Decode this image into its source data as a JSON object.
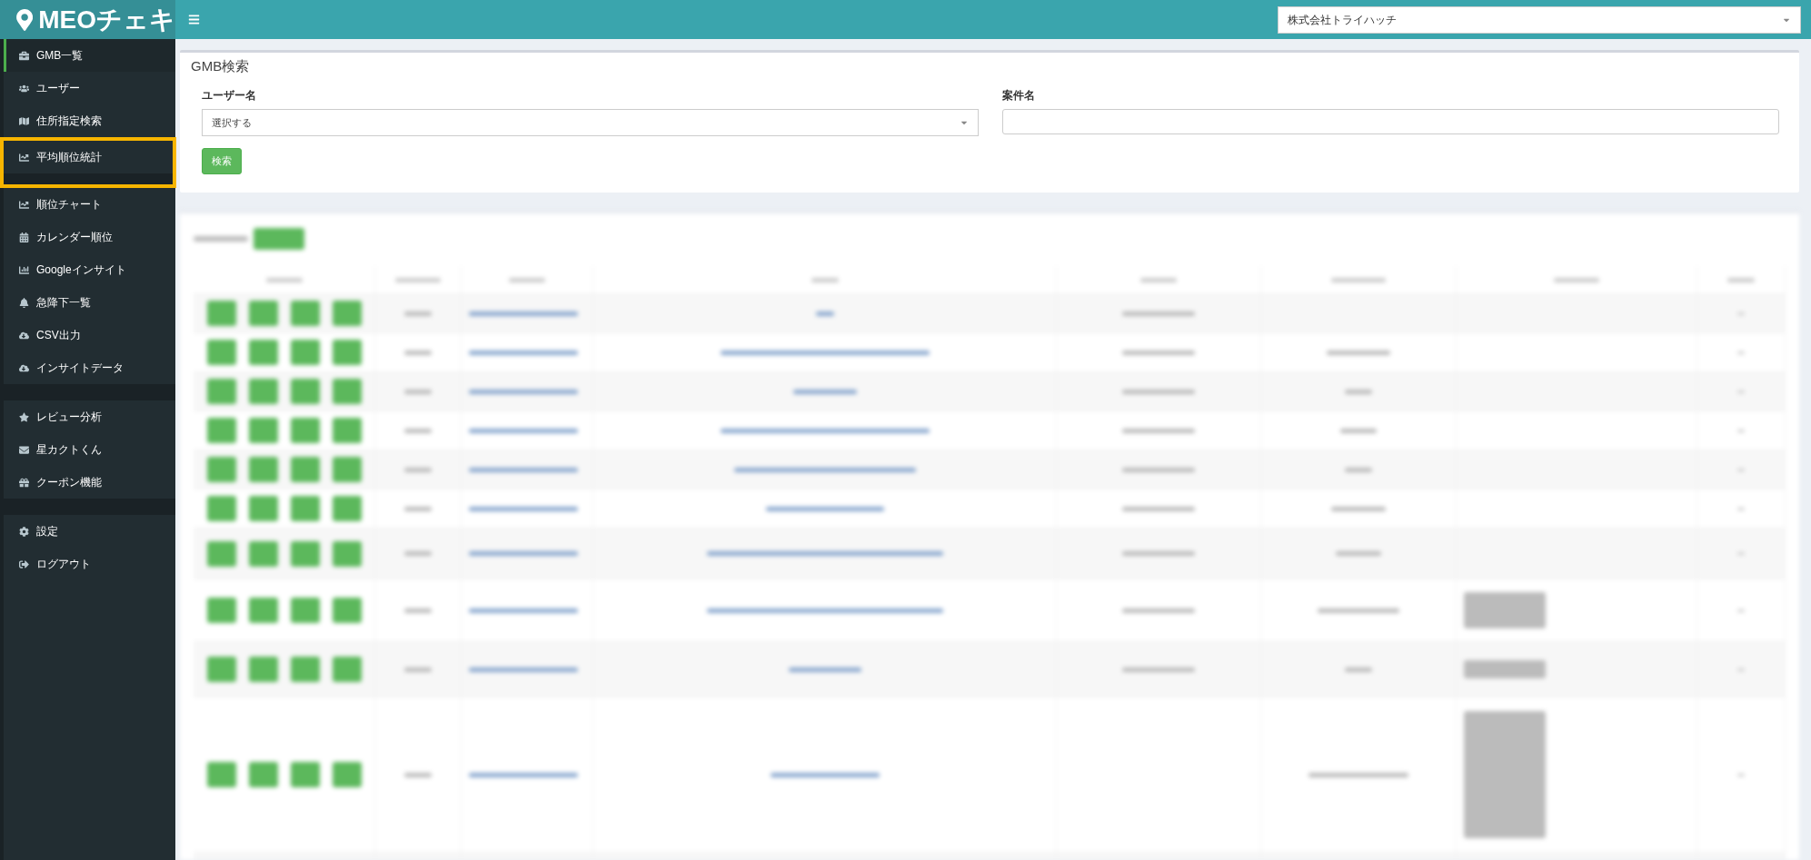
{
  "header": {
    "logo": "MEOチェキ",
    "company_select": {
      "value": "株式会社トライハッチ"
    }
  },
  "sidebar": {
    "groups": [
      {
        "items": [
          {
            "label": "GMB一覧",
            "selected": true,
            "highlighted": false
          },
          {
            "label": "ユーザー",
            "selected": false,
            "highlighted": false
          },
          {
            "label": "住所指定検索",
            "selected": false,
            "highlighted": false
          },
          {
            "label": "平均順位統計",
            "selected": false,
            "highlighted": true
          }
        ]
      },
      {
        "items": [
          {
            "label": "順位チャート",
            "selected": false,
            "highlighted": false
          },
          {
            "label": "カレンダー順位",
            "selected": false,
            "highlighted": false
          },
          {
            "label": "Googleインサイト",
            "selected": false,
            "highlighted": false
          },
          {
            "label": "急降下一覧",
            "selected": false,
            "highlighted": false
          },
          {
            "label": "CSV出力",
            "selected": false,
            "highlighted": false
          },
          {
            "label": "インサイトデータ",
            "selected": false,
            "highlighted": false
          }
        ]
      },
      {
        "items": [
          {
            "label": "レビュー分析",
            "selected": false,
            "highlighted": false
          },
          {
            "label": "星カクトくん",
            "selected": false,
            "highlighted": false
          },
          {
            "label": "クーポン機能",
            "selected": false,
            "highlighted": false
          }
        ]
      },
      {
        "items": [
          {
            "label": "設定",
            "selected": false,
            "highlighted": false
          },
          {
            "label": "ログアウト",
            "selected": false,
            "highlighted": false
          }
        ]
      }
    ]
  },
  "search_panel": {
    "title": "GMB検索",
    "fields": [
      {
        "kind": "select",
        "label": "ユーザー名",
        "value": "選択する"
      },
      {
        "kind": "text",
        "label": "案件名"
      }
    ],
    "button": "検索"
  },
  "results_panel": {
    "kind": "blurred"
  }
}
